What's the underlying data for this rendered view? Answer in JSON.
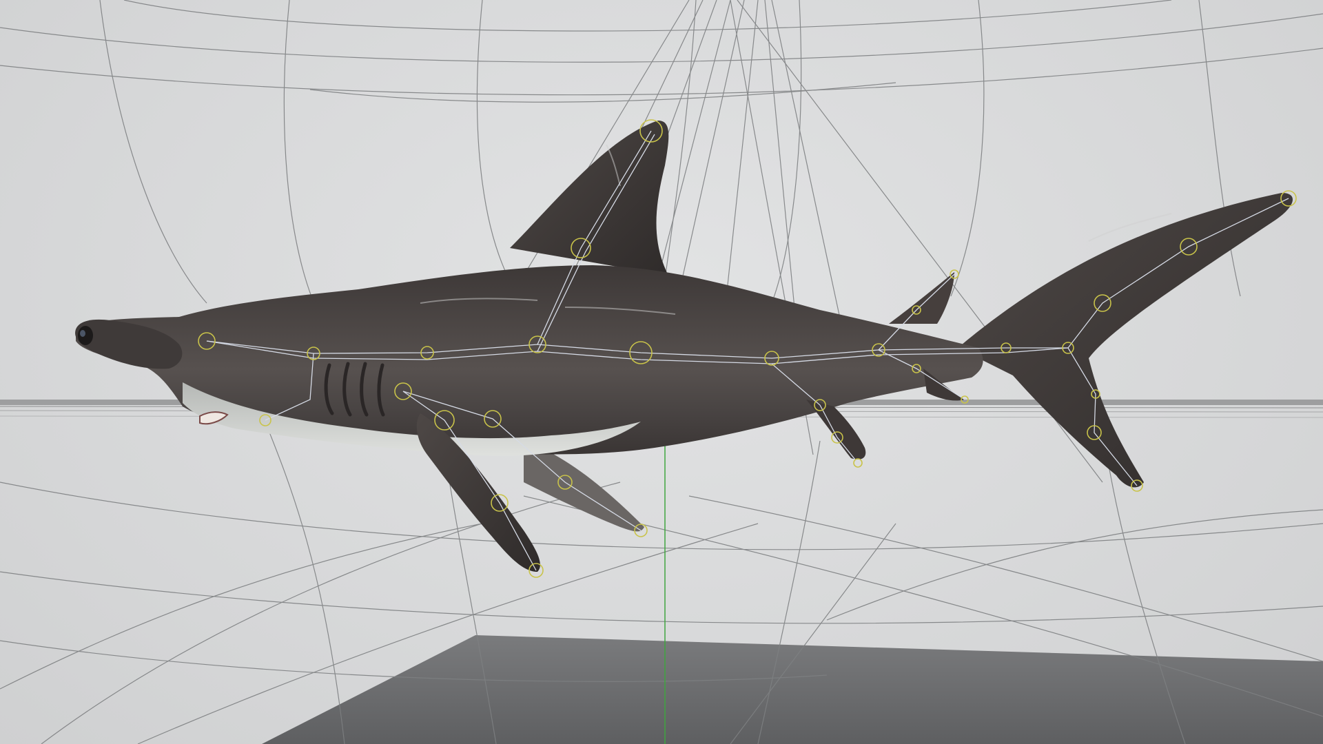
{
  "scene": {
    "subject": "hammerhead-shark",
    "view_mode": "shaded-with-skeleton",
    "colors": {
      "background": "#d7d8d9",
      "wireframe": "#7e8082",
      "floor": "#6f7072",
      "horizon_band": "#9a9b9c",
      "shark_body": "#4f4a48",
      "shark_belly": "#c7cbc8",
      "bone_lines": "#d6dbe6",
      "joint_rings": "#c9c34a",
      "y_axis": "#3fa53f"
    },
    "icons": [
      "shark-model-icon",
      "skeleton-joint-icon",
      "ground-plane-icon",
      "y-axis-guide-icon"
    ]
  }
}
